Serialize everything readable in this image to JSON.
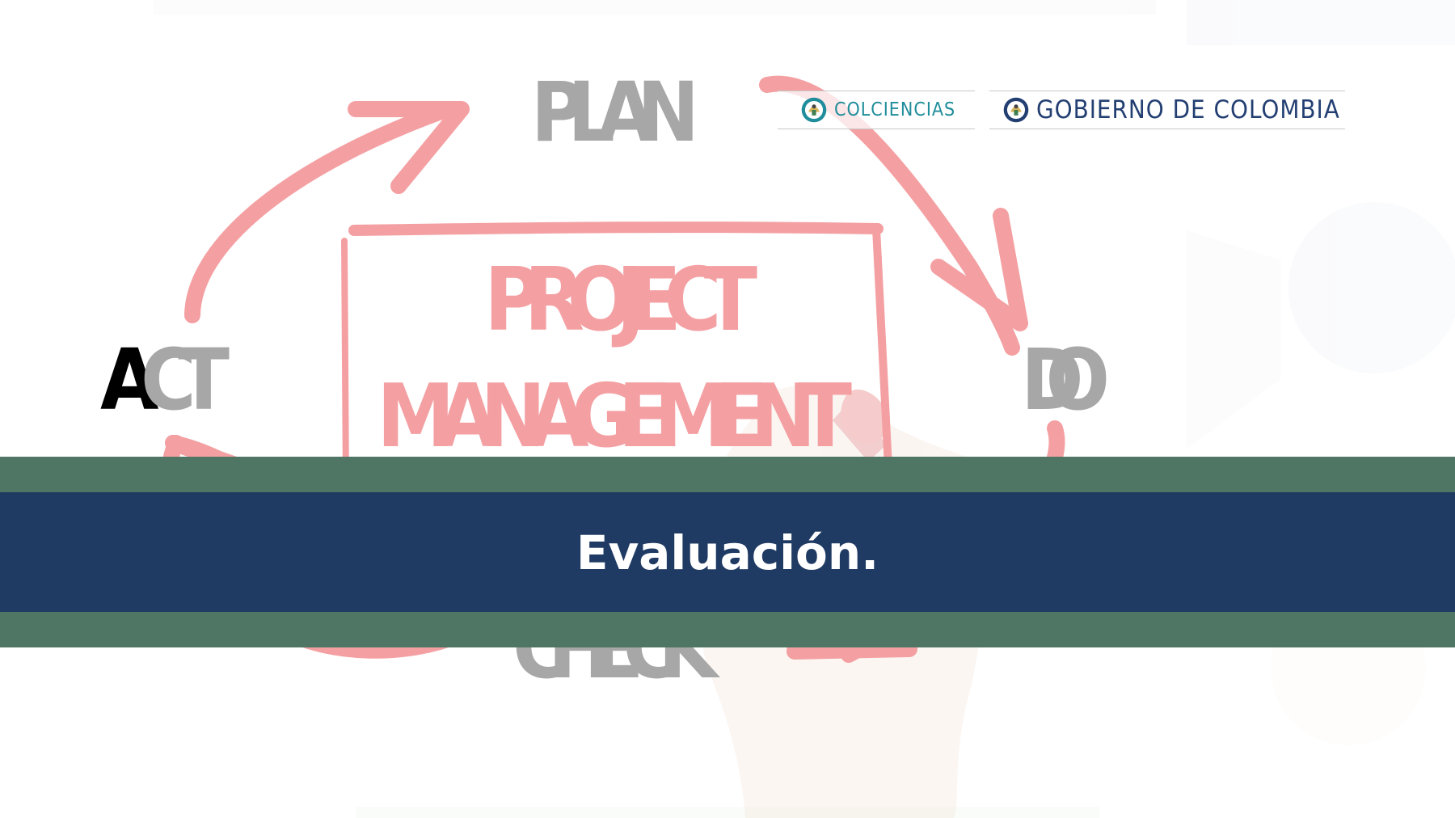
{
  "illustration": {
    "cycle_labels": {
      "plan": "PLAN",
      "do": "DO",
      "check": "CHECK",
      "act": "ACT"
    },
    "board_lines": [
      "PROJECT",
      "MANAGEMENT"
    ],
    "colors": {
      "arrow": "#f4a0a3",
      "board_text": "#f4a0a3",
      "cycle_text": "#a7a7a7",
      "act_highlight": "#000000"
    }
  },
  "logos": {
    "colciencias": "COLCIENCIAS",
    "gobierno": "GOBIERNO DE COLOMBIA"
  },
  "banner": {
    "title": "Evaluación.",
    "colors": {
      "green_band": "#4f7565",
      "blue_band": "#1f3b63",
      "text": "#ffffff"
    }
  }
}
